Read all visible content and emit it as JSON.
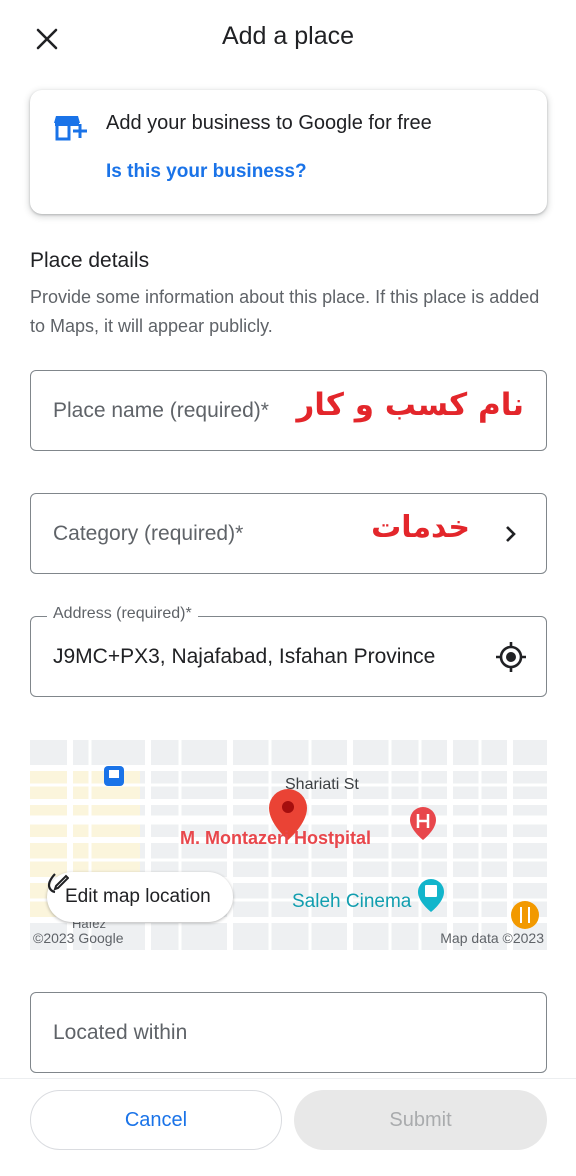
{
  "header": {
    "title": "Add a place",
    "close_icon": "close-icon"
  },
  "business_card": {
    "icon": "storefront-add-icon",
    "text": "Add your business to Google for free",
    "link": "Is this your business?"
  },
  "place_details": {
    "title": "Place details",
    "description": "Provide some information about this place. If this place is added to Maps, it will appear publicly."
  },
  "fields": {
    "place_name": {
      "placeholder": "Place name (required)*",
      "overlay_text": "نام کسب و کار"
    },
    "category": {
      "placeholder": "Category (required)*",
      "overlay_text": "خدمات",
      "chevron_icon": "chevron-right-icon"
    },
    "address": {
      "label": "Address (required)*",
      "value": "J9MC+PX3, Najafabad, Isfahan Province",
      "locate_icon": "my-location-icon"
    },
    "located_within": {
      "placeholder": "Located within"
    }
  },
  "map": {
    "street_label": "Shariati St",
    "poi_hospital": "M. Montazeri Hostpital",
    "poi_cinema": "Saleh Cinema",
    "poi_partial": "Hafez",
    "copyright_left": "©2023 Google",
    "copyright_right": "Map data ©2023",
    "edit_button": "Edit map location",
    "colors": {
      "hospital": "#e8474c",
      "cinema": "#12b5cb",
      "food": "#f29900",
      "pin": "#ea4335",
      "bus": "#1a73e8"
    }
  },
  "footer": {
    "cancel_label": "Cancel",
    "submit_label": "Submit"
  },
  "colors": {
    "accent": "#1a73e8",
    "overlay_red": "#e3262b"
  }
}
